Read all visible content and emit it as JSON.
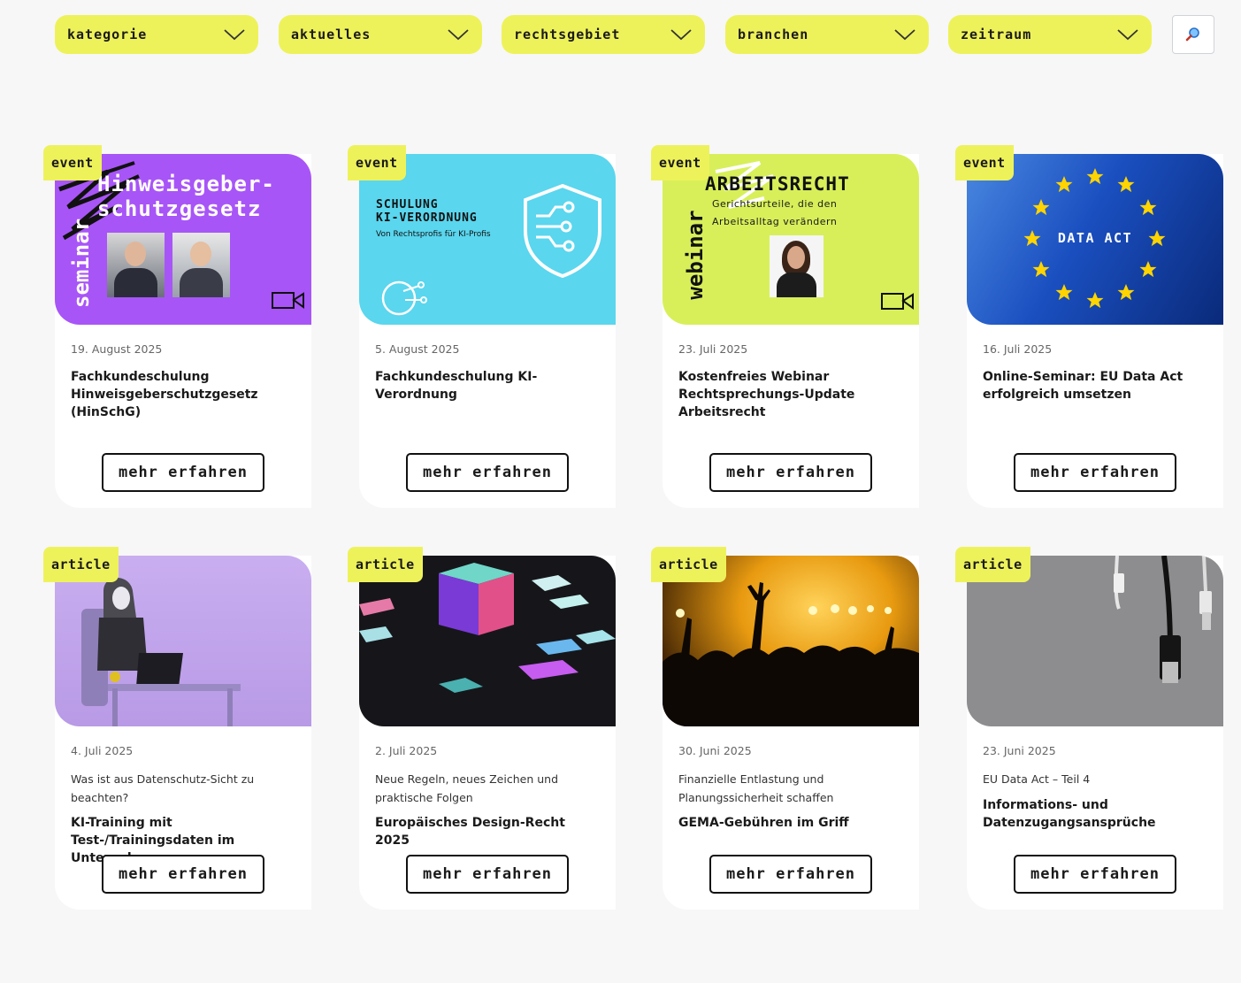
{
  "filters": [
    "Kategorie",
    "Aktuelles",
    "Rechtsgebiet",
    "Branchen",
    "Zeitraum"
  ],
  "search_icon": "search-icon",
  "cards": [
    {
      "tag": "event",
      "date": "19. August 2025",
      "subtitle": "",
      "title": "Fachkundeschulung Hinweisgeberschutzgesetz (HinSchG)",
      "button": "mehr erfahren",
      "media": {
        "line1": "Hinweisgeber-",
        "line2": "schutzgesetz",
        "side": "seminar"
      }
    },
    {
      "tag": "event",
      "date": "5. August 2025",
      "subtitle": "",
      "title": "Fachkundeschulung KI-Verordnung",
      "button": "mehr erfahren",
      "media": {
        "line1": "Schulung",
        "line2": "KI-Verordnung",
        "small": "Von Rechtsprofis für KI-Profis"
      }
    },
    {
      "tag": "event",
      "date": "23. Juli 2025",
      "subtitle": "",
      "title": "Kostenfreies Webinar Rechtsprechungs-Update Arbeitsrecht",
      "button": "mehr erfahren",
      "media": {
        "line1": "Arbeitsrecht",
        "small1": "Gerichtsurteile, die den",
        "small2": "Arbeitsalltag verändern",
        "side": "webinar"
      }
    },
    {
      "tag": "event",
      "date": "16. Juli 2025",
      "subtitle": "",
      "title": "Online-Seminar: EU Data Act erfolgreich umsetzen",
      "button": "mehr erfahren",
      "media": {
        "line1": "Data Act"
      }
    },
    {
      "tag": "article",
      "date": "4. Juli 2025",
      "subtitle": "Was ist aus Datenschutz-Sicht zu beachten?",
      "title": "KI-Training mit Test-/Trainingsdaten im Unternehmen",
      "button": "mehr erfahren"
    },
    {
      "tag": "article",
      "date": "2. Juli 2025",
      "subtitle": "Neue Regeln, neues Zeichen und praktische Folgen",
      "title": "Europäisches Design-Recht 2025",
      "button": "mehr erfahren"
    },
    {
      "tag": "article",
      "date": "30. Juni 2025",
      "subtitle": "Finanzielle Entlastung und Planungssicherheit schaffen",
      "title": "GEMA-Gebühren im Griff",
      "button": "mehr erfahren"
    },
    {
      "tag": "article",
      "date": "23. Juni 2025",
      "subtitle": "EU Data Act – Teil 4",
      "title": "Informations- und Datenzugangsansprüche",
      "button": "mehr erfahren"
    }
  ],
  "colors": {
    "accent": "#eef25a",
    "purple": "#a855f7",
    "cyan": "#5ad6ee",
    "lime": "#d8ef5a",
    "eu_blue": "#0d3da8"
  }
}
